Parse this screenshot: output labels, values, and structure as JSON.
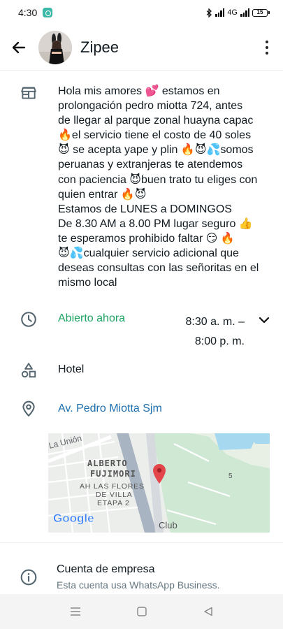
{
  "status_bar": {
    "time": "4:30",
    "network": "4G",
    "battery": "15"
  },
  "header": {
    "title": "Zipee"
  },
  "business": {
    "description_lines": [
      "Hola mis amores 💕 estamos en",
      "prolongación pedro miotta 724, antes",
      "de llegar al parque zonal huayna capac",
      "🔥el servicio tiene el costo de 40 soles",
      "😈 se acepta yape y plin 🔥😈💦somos",
      "peruanas y extranjeras te atendemos",
      "con paciencia 😈buen trato tu eliges con",
      "quien entrar 🔥😈",
      "Estamos de LUNES a DOMINGOS",
      "De 8.30 AM a 8.00 PM lugar seguro 👍",
      "te esperamos prohibido faltar 😏 🔥",
      "😈💦cualquier servicio adicional que",
      "deseas consultas con las señoritas en el",
      "mismo local"
    ],
    "hours_status": "Abierto ahora",
    "hours_open": "8:30 a. m. –",
    "hours_close": "8:00 p. m.",
    "category": "Hotel",
    "address": "Av. Pedro Miotta  Sjm"
  },
  "map": {
    "label_street": "La Unión",
    "label_district_1": "ALBERTO",
    "label_district_2": "FUJIMORI",
    "label_area_1": "AH LAS FLORES",
    "label_area_2": "DE VILLA",
    "label_area_3": "ETAPA 2",
    "label_club": "Club",
    "label_number": "5",
    "brand": "Google"
  },
  "account": {
    "title": "Cuenta de empresa",
    "subtitle": "Esta cuenta usa WhatsApp Business."
  },
  "colors": {
    "open_green": "#1da462",
    "link_blue": "#1c6fae",
    "icon_gray": "#54656f",
    "pin_red": "#e2454a"
  },
  "icons": {
    "back": "back-arrow-icon",
    "more": "more-vert-icon",
    "description": "store-icon",
    "hours": "clock-icon",
    "expand": "chevron-down-icon",
    "category": "category-icon",
    "address": "location-pin-icon",
    "account": "info-icon"
  }
}
